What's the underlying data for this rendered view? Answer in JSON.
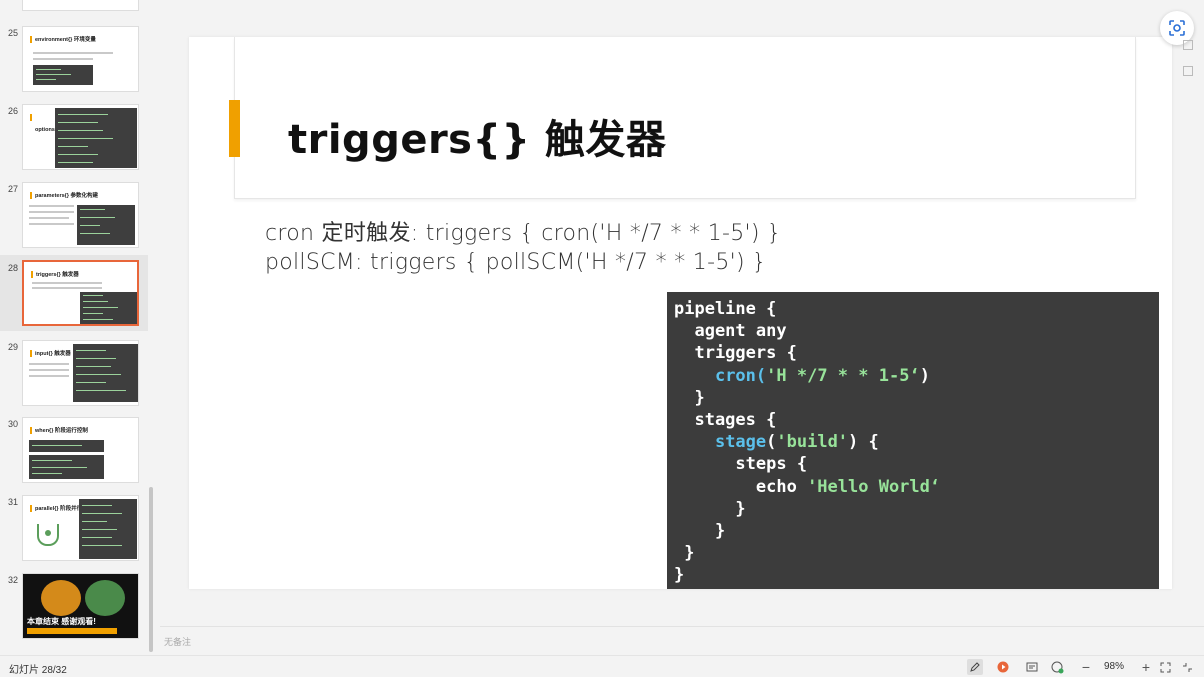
{
  "sidebar": {
    "slides": [
      {
        "num": "25",
        "title": "environment{} 环境变量"
      },
      {
        "num": "26",
        "title": "options{}"
      },
      {
        "num": "27",
        "title": "parameters{} 参数化构建"
      },
      {
        "num": "28",
        "title": "triggers{} 触发器"
      },
      {
        "num": "29",
        "title": "input{} 触发器"
      },
      {
        "num": "30",
        "title": "when{} 阶段运行控制"
      },
      {
        "num": "31",
        "title": "parallel{} 阶段并行"
      },
      {
        "num": "32",
        "title": "本章结束 感谢观看!"
      }
    ],
    "selected_index": 3
  },
  "slide": {
    "title": "triggers{} 触发器",
    "line1": "cron 定时触发: triggers { cron('H */7 * * 1-5') }",
    "line2": "pollSCM: triggers { pollSCM('H */7 * * 1-5') }",
    "code": {
      "l1": "pipeline {",
      "l2": "  agent any",
      "l3": "  triggers {",
      "l4_fn": "cron",
      "l4_str": "'H */7 * * 1-5‘",
      "l5": "  }",
      "l6": "  stages {",
      "l7_fn": "stage",
      "l7_str": "'build'",
      "l8": "      steps {",
      "l9_kw": "        echo ",
      "l9_str": "'Hello World‘",
      "l10": "      }",
      "l11": "    }",
      "l12": " }",
      "l13": "}"
    }
  },
  "notes": {
    "placeholder": "无备注"
  },
  "statusbar": {
    "slide_counter": "幻灯片 28/32",
    "zoom": "98%"
  },
  "colors": {
    "accent": "#f0a000",
    "code_bg": "#3c3c3c",
    "selected_border": "#e8663a"
  }
}
